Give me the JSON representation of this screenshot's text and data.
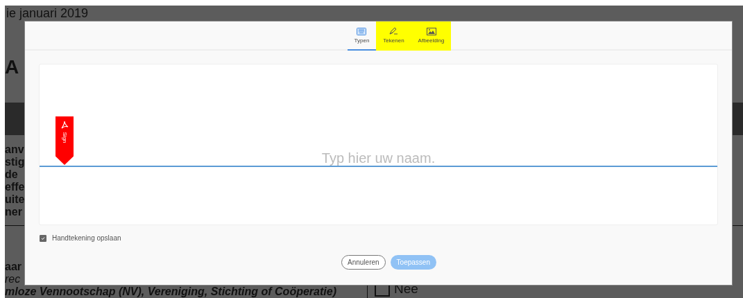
{
  "background_page": {
    "date_fragment": "ie januari 2019",
    "heading_fragment": "A",
    "text_fragments": [
      "anv",
      "stig",
      "de",
      "effe",
      "uite",
      "ner"
    ],
    "section_fragments": [
      {
        "text": "aar",
        "kind": "bold"
      },
      {
        "text": "rec",
        "kind": "italic"
      },
      {
        "text": "mloze Vennootschap (NV), Vereniging, Stichting of Coöperatie)",
        "kind": "bolditalic"
      }
    ],
    "option": {
      "label": "Nee",
      "checked": false
    }
  },
  "dialog": {
    "tabs": [
      {
        "label": "Typen",
        "kind": "keyboard",
        "selected": true,
        "highlighted": false
      },
      {
        "label": "Tekenen",
        "kind": "pen",
        "selected": false,
        "highlighted": true
      },
      {
        "label": "Afbeelding",
        "kind": "image",
        "selected": false,
        "highlighted": true
      }
    ],
    "sign_badge": "Sign",
    "name_field": {
      "placeholder": "Typ hier uw naam."
    },
    "save_signature": {
      "label": "Handtekening opslaan",
      "checked": true
    },
    "buttons": [
      {
        "label": "Annuleren",
        "kind": "secondary",
        "disabled": false
      },
      {
        "label": "Toepassen",
        "kind": "primary",
        "disabled": true
      }
    ]
  }
}
